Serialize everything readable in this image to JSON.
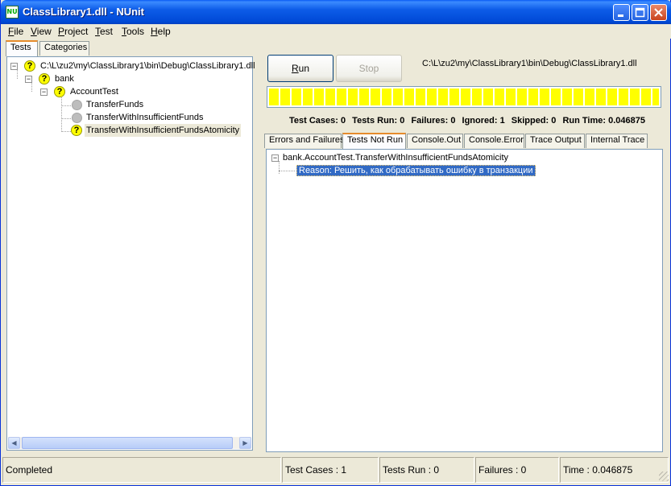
{
  "window": {
    "title": "ClassLibrary1.dll - NUnit",
    "app_icon_text": "NU"
  },
  "menu": {
    "items": [
      {
        "accel": "F",
        "rest": "ile"
      },
      {
        "accel": "V",
        "rest": "iew"
      },
      {
        "accel": "P",
        "rest": "roject"
      },
      {
        "accel": "T",
        "rest": "est"
      },
      {
        "accel": "T",
        "rest": "ools"
      },
      {
        "accel": "H",
        "rest": "elp"
      }
    ]
  },
  "left_tabs": [
    "Tests",
    "Categories"
  ],
  "tree": {
    "root": "C:\\L\\zu2\\my\\ClassLibrary1\\bin\\Debug\\ClassLibrary1.dll",
    "namespace": "bank",
    "fixture": "AccountTest",
    "tests": [
      "TransferFunds",
      "TransferWithInsufficientFunds",
      "TransferWithInsufficientFundsAtomicity"
    ]
  },
  "run_panel": {
    "run_label": "Run",
    "run_accel": "R",
    "stop_label": "Stop",
    "assembly_path": "C:\\L\\zu2\\my\\ClassLibrary1\\bin\\Debug\\ClassLibrary1.dll",
    "progress_fraction": 1.0,
    "progress_color": "#ffff00"
  },
  "stats": {
    "test_cases": "Test Cases: 0",
    "tests_run": "Tests Run: 0",
    "failures": "Failures: 0",
    "ignored": "Ignored: 1",
    "skipped": "Skipped: 0",
    "run_time": "Run Time: 0.046875"
  },
  "result_tabs": [
    "Errors and Failures",
    "Tests Not Run",
    "Console.Out",
    "Console.Error",
    "Trace Output",
    "Internal Trace"
  ],
  "not_run": {
    "test_name": "bank.AccountTest.TransferWithInsufficientFundsAtomicity",
    "reason": "Reason: Решить, как обрабатывать ошибку в транзакции"
  },
  "status": {
    "state": "Completed",
    "test_cases": "Test Cases : 1",
    "tests_run": "Tests Run : 0",
    "failures": "Failures : 0",
    "time": "Time : 0.046875"
  }
}
